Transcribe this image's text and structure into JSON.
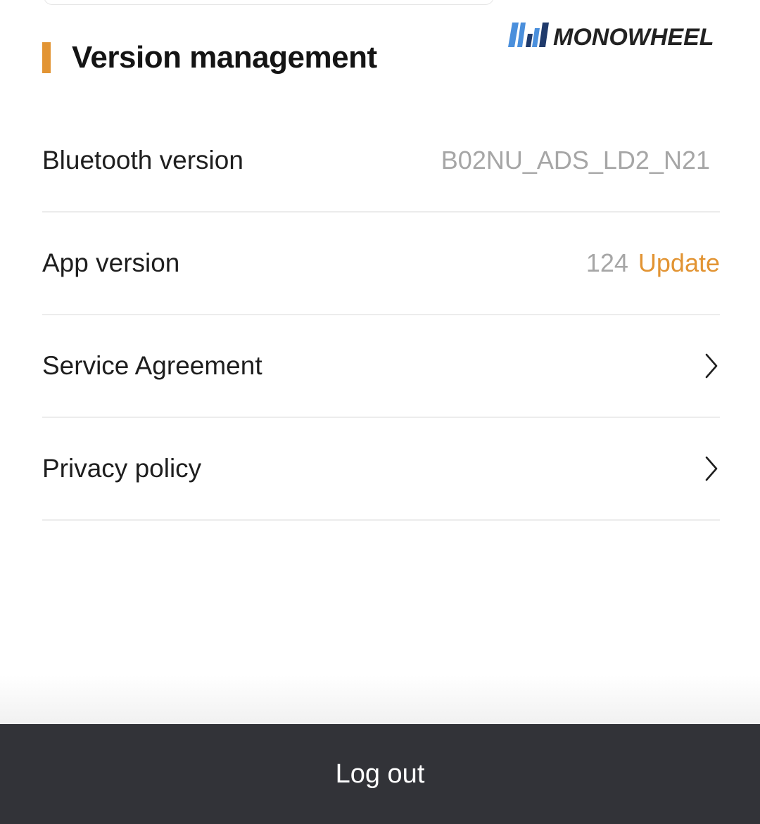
{
  "brand": {
    "name": "MONOWHEEL",
    "icon": "monowheel-logo",
    "colors": {
      "light_blue": "#4a8fdc",
      "dark_navy": "#1f3a6b",
      "text": "#222222"
    }
  },
  "section": {
    "title": "Version management",
    "accent_color": "#e29433"
  },
  "rows": {
    "bluetooth": {
      "label": "Bluetooth version",
      "value": "B02NU_ADS_LD2_N21"
    },
    "app": {
      "label": "App version",
      "value": "124",
      "action": "Update"
    },
    "service": {
      "label": "Service Agreement",
      "icon": "chevron-right-icon"
    },
    "privacy": {
      "label": "Privacy policy",
      "icon": "chevron-right-icon"
    }
  },
  "footer": {
    "logout_label": "Log out",
    "background": "#323338"
  }
}
